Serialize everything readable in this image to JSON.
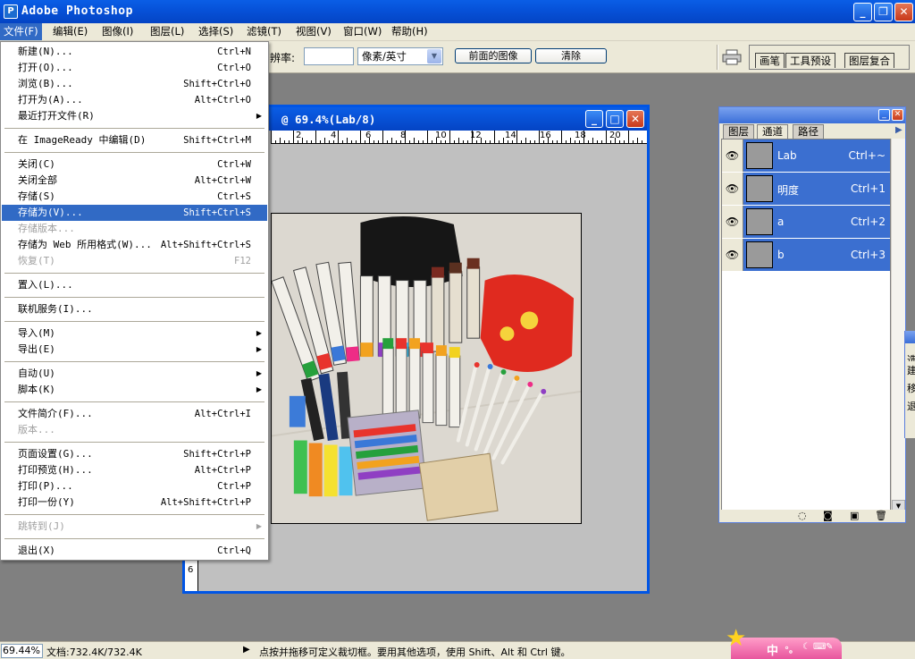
{
  "window": {
    "title": "Adobe Photoshop"
  },
  "menubar": [
    {
      "id": "file",
      "label": "文件(F)",
      "active": true
    },
    {
      "id": "edit",
      "label": "编辑(E)"
    },
    {
      "id": "image",
      "label": "图像(I)"
    },
    {
      "id": "layer",
      "label": "图层(L)"
    },
    {
      "id": "select",
      "label": "选择(S)"
    },
    {
      "id": "filter",
      "label": "滤镜(T)"
    },
    {
      "id": "view",
      "label": "视图(V)"
    },
    {
      "id": "window",
      "label": "窗口(W)"
    },
    {
      "id": "help",
      "label": "帮助(H)"
    }
  ],
  "options": {
    "resolution_label": "辨率:",
    "resolution_value": "",
    "unit": "像素/英寸",
    "front_image_button": "前面的图像",
    "clear_button": "清除",
    "well_tabs": [
      "画笔",
      "工具预设",
      "图层复合"
    ]
  },
  "file_menu": {
    "items": [
      {
        "label": "新建(N)...",
        "shortcut": "Ctrl+N"
      },
      {
        "label": "打开(O)...",
        "shortcut": "Ctrl+O"
      },
      {
        "label": "浏览(B)...",
        "shortcut": "Shift+Ctrl+O"
      },
      {
        "label": "打开为(A)...",
        "shortcut": "Alt+Ctrl+O"
      },
      {
        "label": "最近打开文件(R)",
        "shortcut": "",
        "submenu": true
      },
      {
        "sep": true
      },
      {
        "label": "在 ImageReady 中编辑(D)",
        "shortcut": "Shift+Ctrl+M"
      },
      {
        "sep": true
      },
      {
        "label": "关闭(C)",
        "shortcut": "Ctrl+W"
      },
      {
        "label": "关闭全部",
        "shortcut": "Alt+Ctrl+W"
      },
      {
        "label": "存储(S)",
        "shortcut": "Ctrl+S"
      },
      {
        "label": "存储为(V)...",
        "shortcut": "Shift+Ctrl+S",
        "highlight": true
      },
      {
        "label": "存储版本...",
        "shortcut": "",
        "disabled": true
      },
      {
        "label": "存储为 Web 所用格式(W)...",
        "shortcut": "Alt+Shift+Ctrl+S"
      },
      {
        "label": "恢复(T)",
        "shortcut": "F12",
        "disabled": true
      },
      {
        "sep": true
      },
      {
        "label": "置入(L)...",
        "shortcut": ""
      },
      {
        "sep": true
      },
      {
        "label": "联机服务(I)...",
        "shortcut": ""
      },
      {
        "sep": true
      },
      {
        "label": "导入(M)",
        "shortcut": "",
        "submenu": true
      },
      {
        "label": "导出(E)",
        "shortcut": "",
        "submenu": true
      },
      {
        "sep": true
      },
      {
        "label": "自动(U)",
        "shortcut": "",
        "submenu": true
      },
      {
        "label": "脚本(K)",
        "shortcut": "",
        "submenu": true
      },
      {
        "sep": true
      },
      {
        "label": "文件简介(F)...",
        "shortcut": "Alt+Ctrl+I"
      },
      {
        "label": "版本...",
        "shortcut": "",
        "disabled": true
      },
      {
        "sep": true
      },
      {
        "label": "页面设置(G)...",
        "shortcut": "Shift+Ctrl+P"
      },
      {
        "label": "打印预览(H)...",
        "shortcut": "Alt+Ctrl+P"
      },
      {
        "label": "打印(P)...",
        "shortcut": "Ctrl+P"
      },
      {
        "label": "打印一份(Y)",
        "shortcut": "Alt+Shift+Ctrl+P"
      },
      {
        "sep": true
      },
      {
        "label": "跳转到(J)",
        "shortcut": "",
        "submenu": true,
        "disabled": true
      },
      {
        "sep": true
      },
      {
        "label": "退出(X)",
        "shortcut": "Ctrl+Q"
      }
    ]
  },
  "document": {
    "title": "@ 69.4%(Lab/8)",
    "ruler_ticks": [
      "2",
      "4",
      "6",
      "8",
      "10",
      "12",
      "14",
      "16",
      "18",
      "20"
    ],
    "vruler_label": "6"
  },
  "channels_panel": {
    "tabs": [
      "图层",
      "通道",
      "路径"
    ],
    "active_tab": "通道",
    "channels": [
      {
        "name": "Lab",
        "shortcut": "Ctrl+~"
      },
      {
        "name": "明度",
        "shortcut": "Ctrl+1"
      },
      {
        "name": "a",
        "shortcut": "Ctrl+2"
      },
      {
        "name": "b",
        "shortcut": "Ctrl+3"
      }
    ]
  },
  "right_panel_glyphs": [
    "选",
    "建",
    "移",
    "退"
  ],
  "status": {
    "zoom": "69.44%",
    "doc_size": "文档:732.4K/732.4K",
    "hint": "点按并拖移可定义裁切框。要用其他选项，使用 Shift、Alt 和 Ctrl 键。"
  },
  "ime": {
    "label": "中"
  },
  "colors": {
    "xp_blue": "#0651d8",
    "menu_highlight": "#316ac5",
    "workspace": "#808080"
  }
}
